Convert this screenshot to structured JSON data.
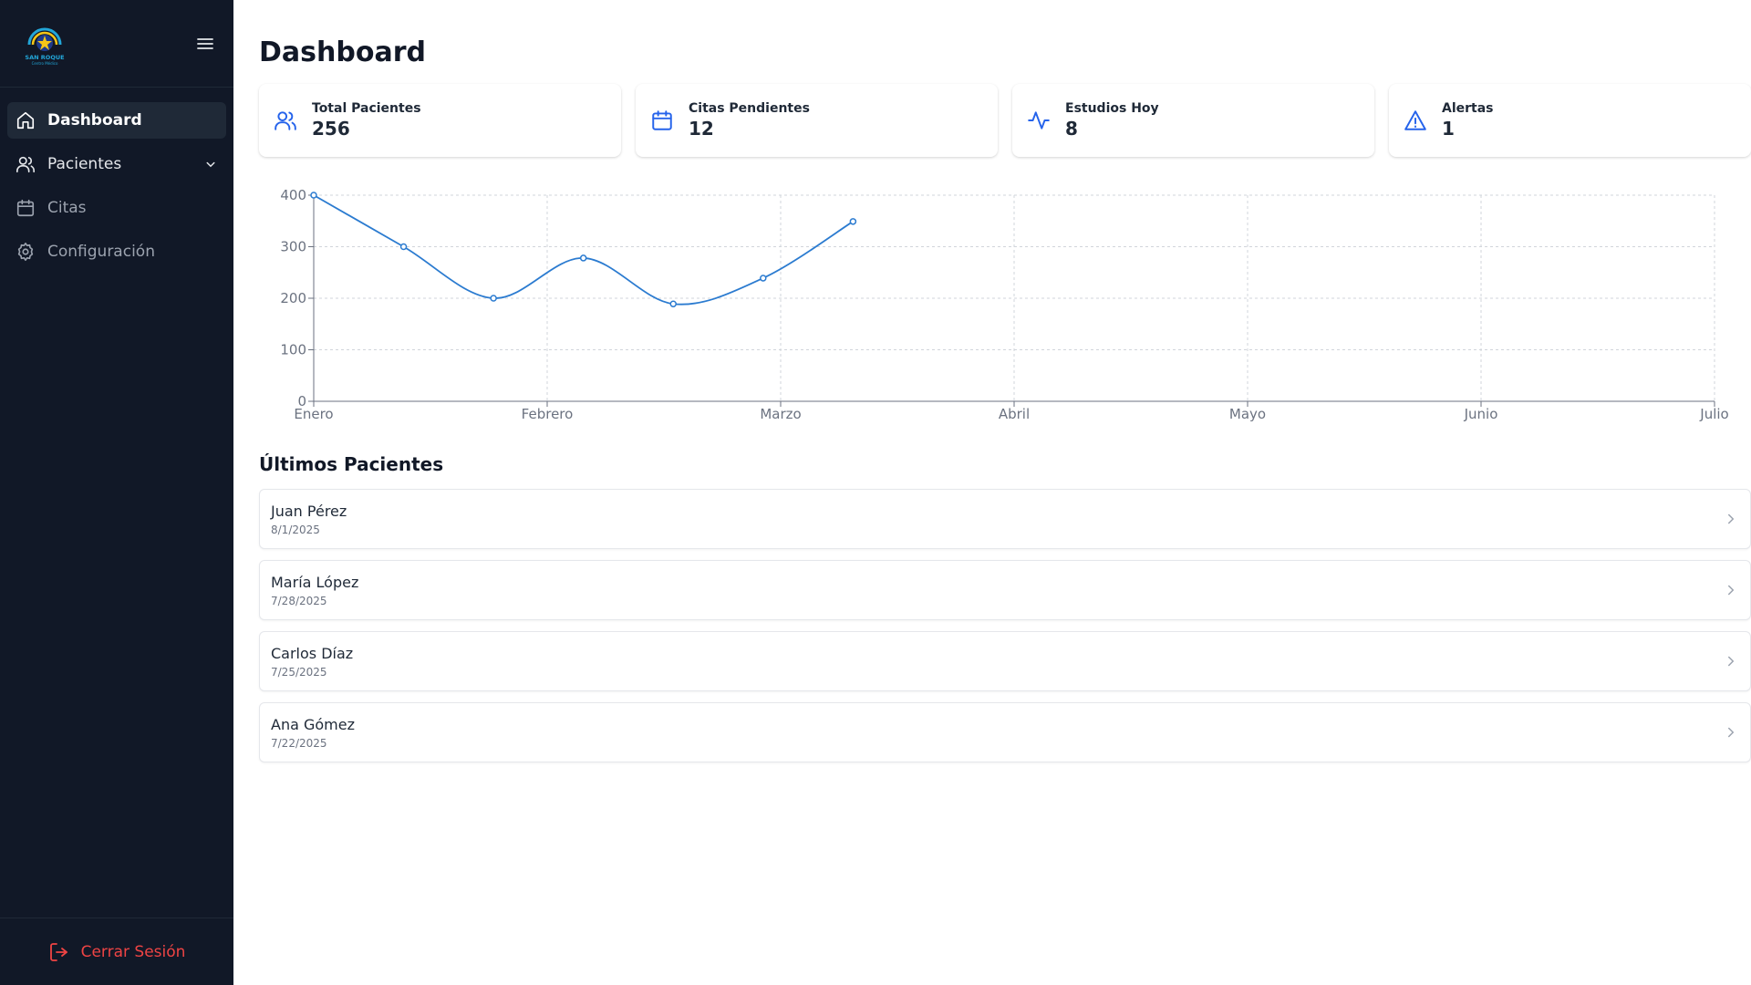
{
  "sidebar": {
    "logo_text": "SAN ROQUE",
    "logo_subtext": "Centro Médico",
    "menu_icon": "hamburger-icon",
    "items": [
      {
        "label": "Dashboard",
        "icon": "home-icon",
        "active": true
      },
      {
        "label": "Pacientes",
        "icon": "users-icon",
        "expandable": true
      },
      {
        "label": "Citas",
        "icon": "calendar-icon"
      },
      {
        "label": "Configuración",
        "icon": "gear-icon"
      }
    ],
    "logout_label": "Cerrar Sesión"
  },
  "main": {
    "title": "Dashboard",
    "cards": [
      {
        "label": "Total Pacientes",
        "value": "256",
        "icon": "users-icon"
      },
      {
        "label": "Citas Pendientes",
        "value": "12",
        "icon": "calendar-icon"
      },
      {
        "label": "Estudios Hoy",
        "value": "8",
        "icon": "activity-icon"
      },
      {
        "label": "Alertas",
        "value": "1",
        "icon": "alert-triangle-icon"
      }
    ],
    "section_title": "Últimos Pacientes",
    "patients": [
      {
        "name": "Juan Pérez",
        "date": "8/1/2025"
      },
      {
        "name": "María López",
        "date": "7/28/2025"
      },
      {
        "name": "Carlos Díaz",
        "date": "7/25/2025"
      },
      {
        "name": "Ana Gómez",
        "date": "7/22/2025"
      }
    ]
  },
  "chart_data": {
    "type": "line",
    "x_ticks": [
      "Enero",
      "Febrero",
      "Marzo",
      "Abril",
      "Mayo",
      "Junio",
      "Julio"
    ],
    "x_range": [
      0,
      6
    ],
    "series": [
      {
        "x": [
          0,
          0.385,
          0.77,
          1.155,
          1.54,
          1.925,
          2.31
        ],
        "values": [
          400,
          300,
          200,
          278,
          189,
          239,
          349
        ]
      }
    ],
    "ylim": [
      0,
      400
    ],
    "y_ticks": [
      0,
      100,
      200,
      300,
      400
    ],
    "grid": true,
    "line_color": "#2b7bd0"
  },
  "colors": {
    "sidebar_bg": "#111827",
    "accent": "#2563eb",
    "danger": "#ef4444"
  }
}
